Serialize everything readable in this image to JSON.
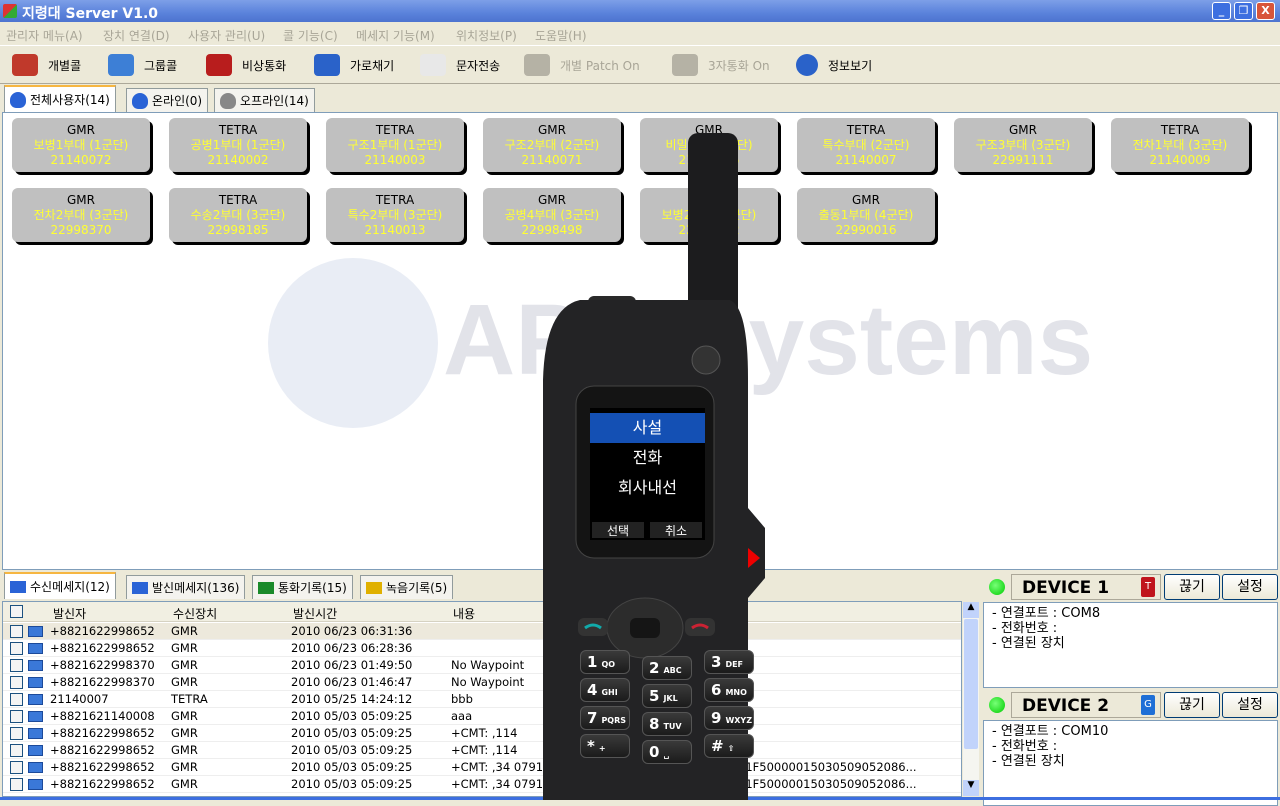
{
  "window": {
    "title": "지령대 Server V1.0",
    "controls": [
      "_",
      "❐",
      "X"
    ]
  },
  "menu": [
    "관리자 메뉴(A)",
    "장치 연결(D)",
    "사용자 관리(U)",
    "콜 기능(C)",
    "메세지 기능(M)",
    "위치정보(P)",
    "도움말(H)"
  ],
  "toolbar": [
    {
      "label": "개별콜",
      "icon": "telephone-icon",
      "color": "#c0392b",
      "disabled": false
    },
    {
      "label": "그룹콜",
      "icon": "megaphone-icon",
      "color": "#3d7fd6",
      "disabled": false
    },
    {
      "label": "비상통화",
      "icon": "siren-icon",
      "color": "#b81d1d",
      "disabled": false
    },
    {
      "label": "가로채기",
      "icon": "download-icon",
      "color": "#2a62c9",
      "disabled": false
    },
    {
      "label": "문자전송",
      "icon": "envelope-icon",
      "color": "#e8e8e8",
      "disabled": false
    },
    {
      "label": "개별 Patch On",
      "icon": "patch-icon",
      "color": "#b5b2a5",
      "disabled": true
    },
    {
      "label": "3자통화 On",
      "icon": "conference-icon",
      "color": "#b5b2a5",
      "disabled": true
    },
    {
      "label": "정보보기",
      "icon": "help-icon",
      "color": "#2a62c9",
      "disabled": false
    }
  ],
  "user_tabs": [
    {
      "label": "전체사용자(14)",
      "active": true
    },
    {
      "label": "온라인(0)",
      "active": false
    },
    {
      "label": "오프라인(14)",
      "active": false
    }
  ],
  "watermark": "APC Systems",
  "users": [
    {
      "type": "GMR",
      "name": "보병1부대 (1군단)",
      "id": "21140072"
    },
    {
      "type": "TETRA",
      "name": "공병1부대 (1군단)",
      "id": "21140002"
    },
    {
      "type": "TETRA",
      "name": "구조1부대 (1군단)",
      "id": "21140003"
    },
    {
      "type": "GMR",
      "name": "구조2부대 (2군단)",
      "id": "21140071"
    },
    {
      "type": "GMR",
      "name": "비밀부대 (2군단)",
      "id": "21140005"
    },
    {
      "type": "TETRA",
      "name": "특수부대 (2군단)",
      "id": "21140007"
    },
    {
      "type": "GMR",
      "name": "구조3부대 (3군단)",
      "id": "22991111"
    },
    {
      "type": "TETRA",
      "name": "전차1부대 (3군단)",
      "id": "21140009"
    },
    {
      "type": "GMR",
      "name": "전차2부대 (3군단)",
      "id": "22998370"
    },
    {
      "type": "TETRA",
      "name": "수송2부대 (3군단)",
      "id": "22998185"
    },
    {
      "type": "TETRA",
      "name": "특수2부대 (3군단)",
      "id": "21140013"
    },
    {
      "type": "GMR",
      "name": "공병4부대 (3군단)",
      "id": "22998498"
    },
    {
      "type": "GMR",
      "name": "보병2부대 (3군단)",
      "id": "22990012"
    },
    {
      "type": "GMR",
      "name": "출동1부대 (4군단)",
      "id": "22990016"
    }
  ],
  "message_tabs": [
    {
      "label": "수신메세지(12)",
      "icon": "envelope-icon",
      "active": true
    },
    {
      "label": "발신메세지(136)",
      "icon": "envelope-send-icon",
      "active": false
    },
    {
      "label": "통화기록(15)",
      "icon": "phone-icon",
      "active": false
    },
    {
      "label": "녹음기록(5)",
      "icon": "tape-icon",
      "active": false
    }
  ],
  "table": {
    "columns": [
      "발신자",
      "수신장치",
      "발신시간",
      "내용"
    ],
    "rows": [
      {
        "sender": "+8821622998652",
        "device": "GMR",
        "time": "2010 06/23 06:31:36",
        "content": "",
        "tail": ""
      },
      {
        "sender": "+8821622998652",
        "device": "GMR",
        "time": "2010 06/23 06:28:36",
        "content": "",
        "tail": ""
      },
      {
        "sender": "+8821622998370",
        "device": "GMR",
        "time": "2010 06/23 01:49:50",
        "content": "No Waypoint",
        "tail": ""
      },
      {
        "sender": "+8821622998370",
        "device": "GMR",
        "time": "2010 06/23 01:46:47",
        "content": "No Waypoint",
        "tail": ""
      },
      {
        "sender": "21140007",
        "device": "TETRA",
        "time": "2010 05/25 14:24:12",
        "content": "bbb",
        "tail": ""
      },
      {
        "sender": "+8821621140008",
        "device": "GMR",
        "time": "2010 05/03 05:09:25",
        "content": "aaa",
        "tail": ""
      },
      {
        "sender": "+8821622998652",
        "device": "GMR",
        "time": "2010 05/03 05:09:25",
        "content": "+CMT: ,114",
        "tail": ""
      },
      {
        "sender": "+8821622998652",
        "device": "GMR",
        "time": "2010 05/03 05:09:25",
        "content": "+CMT: ,114",
        "tail": ""
      },
      {
        "sender": "+8821622998652",
        "device": "GMR",
        "time": "2010 05/03 05:09:25",
        "content": "+CMT: ,34  07918",
        "tail": "31F50000015030509052086..."
      },
      {
        "sender": "+8821622998652",
        "device": "GMR",
        "time": "2010 05/03 05:09:25",
        "content": "+CMT: ,34  07918",
        "tail": "31F50000015030509052086..."
      }
    ]
  },
  "devices": [
    {
      "name": "DEVICE 1",
      "status": "connected",
      "badge": "T",
      "badge_color": "#c0141c",
      "disconnect": "끊기",
      "settings": "설정",
      "lines": [
        "- 연결포트 : COM8",
        "- 전화번호 :",
        "- 연결된 장치"
      ]
    },
    {
      "name": "DEVICE 2",
      "status": "connected",
      "badge": "G",
      "badge_color": "#1e6fd6",
      "disconnect": "끊기",
      "settings": "설정",
      "lines": [
        "- 연결포트 : COM10",
        "- 전화번호 :",
        "- 연결된 장치"
      ]
    }
  ],
  "phone": {
    "menu": [
      "사설",
      "전화",
      "회사내선"
    ],
    "selected": 0,
    "soft_left": "선택",
    "soft_right": "취소",
    "keys": [
      [
        "1",
        "QO"
      ],
      [
        "2",
        "ABC"
      ],
      [
        "3",
        "DEF"
      ],
      [
        "4",
        "GHI"
      ],
      [
        "5",
        "JKL"
      ],
      [
        "6",
        "MNO"
      ],
      [
        "7",
        "PQRS"
      ],
      [
        "8",
        "TUV"
      ],
      [
        "9",
        "WXYZ"
      ],
      [
        "*",
        "+"
      ],
      [
        "0",
        "␣"
      ],
      [
        "#",
        "⇧"
      ]
    ]
  },
  "colors": {
    "selection": "#1450b4",
    "card_text": "#ffff33",
    "card_bg": "#c0c0c0"
  }
}
